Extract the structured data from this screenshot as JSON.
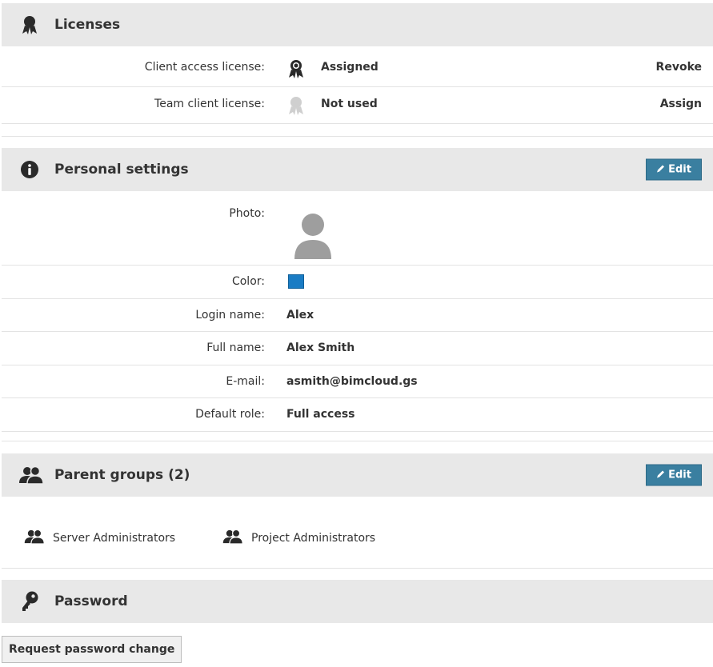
{
  "licenses": {
    "title": "Licenses",
    "items": [
      {
        "label": "Client access license:",
        "status": "Assigned",
        "action": "Revoke"
      },
      {
        "label": "Team client license:",
        "status": "Not used",
        "action": "Assign"
      }
    ]
  },
  "personal": {
    "title": "Personal settings",
    "edit_label": "Edit",
    "photo_label": "Photo:",
    "color_label": "Color:",
    "color_value": "#1a7cc4",
    "login_label": "Login name:",
    "login_value": "Alex",
    "fullname_label": "Full name:",
    "fullname_value": "Alex Smith",
    "email_label": "E-mail:",
    "email_value": "asmith@bimcloud.gs",
    "role_label": "Default role:",
    "role_value": "Full access"
  },
  "groups": {
    "title": "Parent groups (2)",
    "edit_label": "Edit",
    "items": [
      "Server Administrators",
      "Project Administrators"
    ]
  },
  "password": {
    "title": "Password",
    "request_label": "Request password change"
  },
  "icons": {
    "licenses": "award-ribbon-icon",
    "personal": "info-icon",
    "groups": "users-icon",
    "password": "key-icon",
    "edit": "pencil-icon"
  }
}
